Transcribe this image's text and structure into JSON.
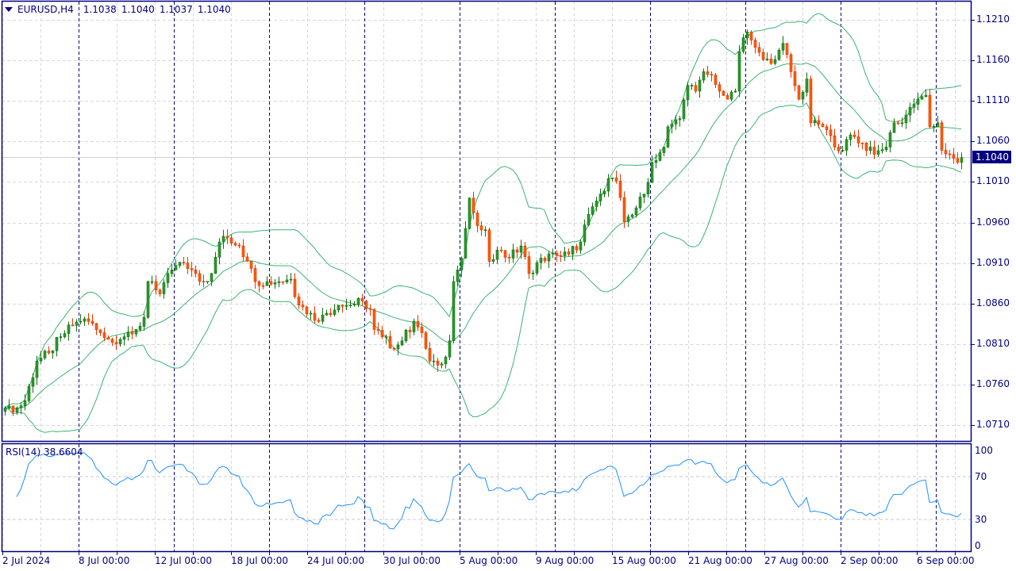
{
  "header": {
    "symbol": "EURUSD,H4",
    "open": "1.1038",
    "high": "1.1040",
    "low": "1.1037",
    "close": "1.1040"
  },
  "current_price": "1.1040",
  "price_axis": [
    "1.1210",
    "1.1160",
    "1.1110",
    "1.1060",
    "1.1010",
    "1.0960",
    "1.0910",
    "1.0860",
    "1.0810",
    "1.0760",
    "1.0710"
  ],
  "rsi": {
    "label": "RSI(14) 38.6604",
    "axis": [
      "100",
      "70",
      "30",
      "0"
    ]
  },
  "time_axis": [
    "2 Jul 2024",
    "8 Jul 00:00",
    "12 Jul 00:00",
    "18 Jul 00:00",
    "24 Jul 00:00",
    "30 Jul 00:00",
    "5 Aug 00:00",
    "9 Aug 00:00",
    "15 Aug 00:00",
    "21 Aug 00:00",
    "27 Aug 00:00",
    "2 Sep 00:00",
    "6 Sep 00:00"
  ],
  "colors": {
    "bull": "#2b9a2b",
    "bull_edge": "#127012",
    "bear": "#ff5a00",
    "bear_edge": "#e03800",
    "bands": "#3cb371",
    "rsi": "#1e90ff",
    "axis": "#000080"
  },
  "chart_data": {
    "type": "candlestick",
    "symbol": "EURUSD",
    "timeframe": "H4",
    "ylim": [
      1.0685,
      1.1225
    ],
    "bars": 242,
    "indicators": [
      "Bollinger Bands(20,2)",
      "RSI(14)"
    ],
    "rsi_ylim": [
      0,
      100
    ],
    "rsi_levels": [
      30,
      70
    ],
    "close_anchors": [
      [
        0,
        1.0731
      ],
      [
        2,
        1.0726
      ],
      [
        5,
        1.074
      ],
      [
        8,
        1.0789
      ],
      [
        11,
        1.0799
      ],
      [
        14,
        1.0819
      ],
      [
        17,
        1.0833
      ],
      [
        19,
        1.0838
      ],
      [
        21,
        1.0838
      ],
      [
        24,
        1.0824
      ],
      [
        27,
        1.0812
      ],
      [
        30,
        1.0819
      ],
      [
        33,
        1.0828
      ],
      [
        35,
        1.0843
      ],
      [
        36,
        1.0887
      ],
      [
        39,
        1.0872
      ],
      [
        41,
        1.0897
      ],
      [
        43,
        1.0907
      ],
      [
        45,
        1.091
      ],
      [
        48,
        1.0897
      ],
      [
        50,
        1.0887
      ],
      [
        52,
        1.0897
      ],
      [
        54,
        1.0936
      ],
      [
        56,
        1.0941
      ],
      [
        59,
        1.0931
      ],
      [
        61,
        1.0912
      ],
      [
        63,
        1.0887
      ],
      [
        66,
        1.0887
      ],
      [
        69,
        1.0887
      ],
      [
        72,
        1.089
      ],
      [
        74,
        1.0858
      ],
      [
        77,
        1.0848
      ],
      [
        79,
        1.0838
      ],
      [
        81,
        1.0848
      ],
      [
        84,
        1.0858
      ],
      [
        87,
        1.0858
      ],
      [
        90,
        1.0863
      ],
      [
        92,
        1.0853
      ],
      [
        93,
        1.0828
      ],
      [
        95,
        1.0819
      ],
      [
        98,
        1.0804
      ],
      [
        100,
        1.0814
      ],
      [
        103,
        1.0838
      ],
      [
        105,
        1.0824
      ],
      [
        107,
        1.0789
      ],
      [
        109,
        1.0784
      ],
      [
        111,
        1.0794
      ],
      [
        112,
        1.0814
      ],
      [
        113,
        1.0887
      ],
      [
        115,
        1.0916
      ],
      [
        117,
        1.099
      ],
      [
        119,
        1.0956
      ],
      [
        121,
        1.0951
      ],
      [
        122,
        1.0912
      ],
      [
        124,
        1.0926
      ],
      [
        127,
        1.0916
      ],
      [
        130,
        1.0931
      ],
      [
        132,
        1.0897
      ],
      [
        135,
        1.0916
      ],
      [
        139,
        1.0919
      ],
      [
        142,
        1.0921
      ],
      [
        145,
        1.0936
      ],
      [
        147,
        1.097
      ],
      [
        150,
        1.0995
      ],
      [
        152,
        1.1014
      ],
      [
        154,
        1.1011
      ],
      [
        156,
        1.0961
      ],
      [
        159,
        1.0978
      ],
      [
        161,
        1.0995
      ],
      [
        163,
        1.1034
      ],
      [
        166,
        1.1053
      ],
      [
        167,
        1.1078
      ],
      [
        170,
        1.1088
      ],
      [
        172,
        1.1129
      ],
      [
        174,
        1.1122
      ],
      [
        176,
        1.1146
      ],
      [
        178,
        1.1142
      ],
      [
        180,
        1.1122
      ],
      [
        182,
        1.1112
      ],
      [
        184,
        1.1122
      ],
      [
        185,
        1.1171
      ],
      [
        187,
        1.1195
      ],
      [
        189,
        1.1176
      ],
      [
        191,
        1.1161
      ],
      [
        194,
        1.1161
      ],
      [
        196,
        1.1181
      ],
      [
        198,
        1.1146
      ],
      [
        200,
        1.1112
      ],
      [
        202,
        1.1137
      ],
      [
        203,
        1.1083
      ],
      [
        206,
        1.1078
      ],
      [
        209,
        1.1053
      ],
      [
        211,
        1.1049
      ],
      [
        213,
        1.1068
      ],
      [
        216,
        1.1058
      ],
      [
        219,
        1.1044
      ],
      [
        222,
        1.1053
      ],
      [
        224,
        1.1083
      ],
      [
        226,
        1.1083
      ],
      [
        228,
        1.1102
      ],
      [
        230,
        1.1112
      ],
      [
        232,
        1.1117
      ],
      [
        233,
        1.1078
      ],
      [
        235,
        1.1083
      ],
      [
        236,
        1.1049
      ],
      [
        239,
        1.1039
      ],
      [
        240,
        1.1034
      ],
      [
        241,
        1.104
      ]
    ]
  }
}
